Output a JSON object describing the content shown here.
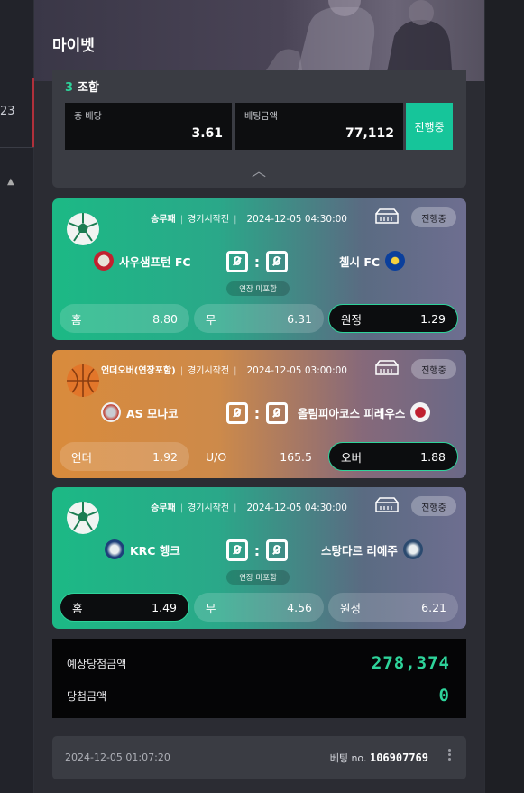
{
  "background": {
    "left_number": "23"
  },
  "panel": {
    "title": "마이벳"
  },
  "combo": {
    "count": "3",
    "label": "조합",
    "total_odds_label": "총 배당",
    "total_odds_value": "3.61",
    "bet_amount_label": "베팅금액",
    "bet_amount_value": "77,112",
    "status": "진행중"
  },
  "matches": [
    {
      "sport": "soccer",
      "market": "승무패",
      "state": "경기시작전",
      "datetime": "2024-12-05 04:30:00",
      "status": "진행중",
      "home": "사우샘프턴 FC",
      "away": "첼시 FC",
      "home_score": "0",
      "away_score": "0",
      "note": "연장 미포함",
      "odds": [
        {
          "label": "홈",
          "value": "8.80",
          "selected": false
        },
        {
          "label": "무",
          "value": "6.31",
          "selected": false
        },
        {
          "label": "원정",
          "value": "1.29",
          "selected": true
        }
      ]
    },
    {
      "sport": "basketball",
      "market": "언더오버(연장포함)",
      "state": "경기시작전",
      "datetime": "2024-12-05 03:00:00",
      "status": "진행중",
      "home": "AS 모나코",
      "away": "올림피아코스 피레우스",
      "home_score": "0",
      "away_score": "0",
      "odds": [
        {
          "label": "언더",
          "value": "1.92",
          "selected": false
        },
        {
          "label": "U/O",
          "value": "165.5",
          "selected": false
        },
        {
          "label": "오버",
          "value": "1.88",
          "selected": true
        }
      ]
    },
    {
      "sport": "soccer",
      "market": "승무패",
      "state": "경기시작전",
      "datetime": "2024-12-05 04:30:00",
      "status": "진행중",
      "home": "KRC 헹크",
      "away": "스탕다르 리에주",
      "home_score": "0",
      "away_score": "0",
      "note": "연장 미포함",
      "odds": [
        {
          "label": "홈",
          "value": "1.49",
          "selected": true
        },
        {
          "label": "무",
          "value": "4.56",
          "selected": false
        },
        {
          "label": "원정",
          "value": "6.21",
          "selected": false
        }
      ]
    }
  ],
  "totals": {
    "expected_label": "예상당첨금액",
    "expected_value": "278,374",
    "won_label": "당첨금액",
    "won_value": "0"
  },
  "bet": {
    "timestamp": "2024-12-05 01:07:20",
    "number_label": "베팅 no.",
    "number_value": "106907769"
  },
  "colors": {
    "accent": "#2ed39a",
    "status_btn": "#16c59a",
    "card_green": "#1cb985",
    "card_orange": "#d98b3c"
  }
}
